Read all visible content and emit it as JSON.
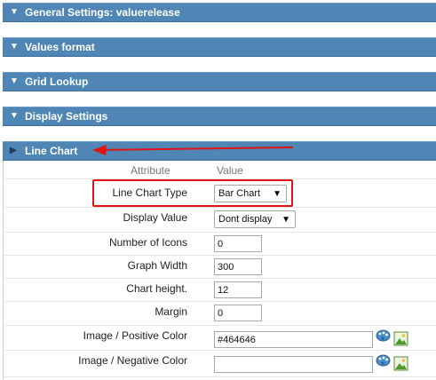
{
  "sections": {
    "general": {
      "label": "General Settings: valuerelease"
    },
    "values_format": {
      "label": "Values format"
    },
    "grid_lookup": {
      "label": "Grid Lookup"
    },
    "display_settings": {
      "label": "Display Settings"
    },
    "line_chart": {
      "label": "Line Chart"
    }
  },
  "table": {
    "attribute_header": "Attribute",
    "value_header": "Value"
  },
  "fields": {
    "line_chart_type": {
      "label": "Line Chart Type",
      "value": "Bar Chart"
    },
    "display_value": {
      "label": "Display Value",
      "value": "Dont display"
    },
    "number_of_icons": {
      "label": "Number of Icons",
      "value": "0"
    },
    "graph_width": {
      "label": "Graph Width",
      "value": "300"
    },
    "chart_height": {
      "label": "Chart height.",
      "value": "12"
    },
    "margin": {
      "label": "Margin",
      "value": "0"
    },
    "positive_color": {
      "label": "Image / Positive Color",
      "value": "#464646"
    },
    "negative_color": {
      "label": "Image / Negative Color",
      "value": ""
    }
  },
  "icons": {
    "section_expanded": "triangle-down-icon",
    "section_collapsed": "triangle-right-icon",
    "color_picker": "color-palette-icon",
    "image_picker": "image-picker-icon",
    "dropdown": "chevron-down-icon"
  },
  "colors": {
    "section_bar": "#4f86b5",
    "annotation": "#e01414"
  }
}
